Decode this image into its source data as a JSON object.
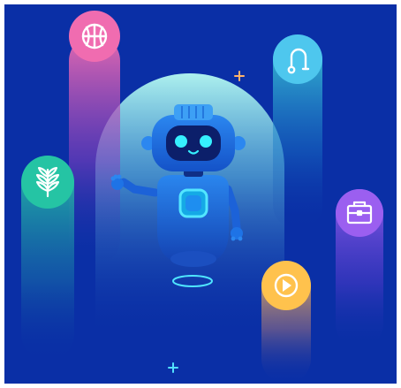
{
  "scene": {
    "colors": {
      "background": "#0a2fa6",
      "frame": "#ffffff",
      "arch_glow": "#8ff3ee",
      "robot_body": "#1e73e6",
      "robot_dark": "#0f2f86",
      "eye_cyan": "#36f0ff",
      "sparkle_orange": "#ffb36b",
      "sparkle_cyan": "#52e0ff"
    },
    "pillars": [
      {
        "name": "basketball",
        "icon": "basketball-icon",
        "color_top": "#f06cb0",
        "color_bottom": "#0a2fa6"
      },
      {
        "name": "stethoscope",
        "icon": "stethoscope-icon",
        "color_top": "#4ec7ee",
        "color_bottom": "#0a2fa6"
      },
      {
        "name": "plant",
        "icon": "leaf-sprig-icon",
        "color_top": "#25c4a4",
        "color_bottom": "#0a2fa6"
      },
      {
        "name": "briefcase",
        "icon": "briefcase-icon",
        "color_top": "#9b5ff0",
        "color_bottom": "#0a2fa6"
      },
      {
        "name": "media",
        "icon": "play-icon",
        "color_top": "#ffc24d",
        "color_bottom": "#0a2fa6"
      }
    ]
  }
}
